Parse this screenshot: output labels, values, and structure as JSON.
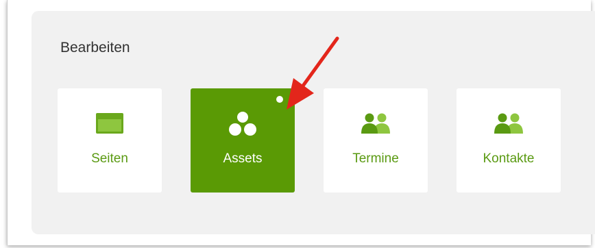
{
  "section": {
    "title": "Bearbeiten"
  },
  "tiles": [
    {
      "label": "Seiten",
      "icon": "window-icon"
    },
    {
      "label": "Assets",
      "icon": "assets-icon",
      "active": true
    },
    {
      "label": "Termine",
      "icon": "people-icon"
    },
    {
      "label": "Kontakte",
      "icon": "people-icon"
    }
  ],
  "colors": {
    "accent": "#5a9a05",
    "label": "#5a9a12",
    "arrow": "#e3261b"
  }
}
